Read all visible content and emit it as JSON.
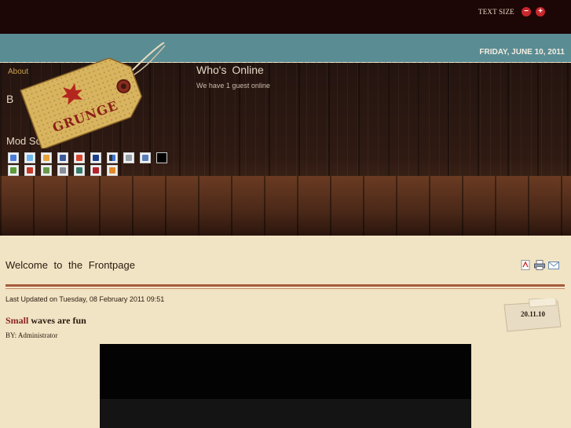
{
  "header": {
    "text_size_label": "TEXT SIZE",
    "decrease_label": "−",
    "increase_label": "+",
    "date": "FRIDAY, JUNE 10, 2011"
  },
  "logo": {
    "text": "GRUNGE"
  },
  "sidebar": {
    "about_text": "About",
    "heading_partial": "B",
    "mod_social_title": "Mod Social",
    "social_icons": [
      "google",
      "twitter",
      "windows-live",
      "facebook",
      "stumbleupon",
      "myspace",
      "delicious",
      "digg",
      "reddit",
      "bookmark",
      "technorati",
      "jumptags",
      "yahoo",
      "mixx",
      "newsvine",
      "favorites",
      "blank"
    ]
  },
  "whos_online": {
    "title": "Who's Online",
    "text": "We have 1 guest online"
  },
  "main": {
    "page_heading": "Welcome to the Frontpage",
    "tools": [
      "pdf-icon",
      "print-icon",
      "email-icon"
    ],
    "last_updated": "Last Updated on Tuesday, 08 February 2011 09:51",
    "article_title_accent": "Small",
    "article_title_rest": " waves are fun",
    "byline": "BY: Administrator",
    "date_badge": "20.11.10"
  },
  "colors": {
    "topbar": "#1d0606",
    "teal": "#5a8c93",
    "accent_red": "#8a2220",
    "rule": "#a65a3d",
    "paper": "#f1e4c4"
  }
}
